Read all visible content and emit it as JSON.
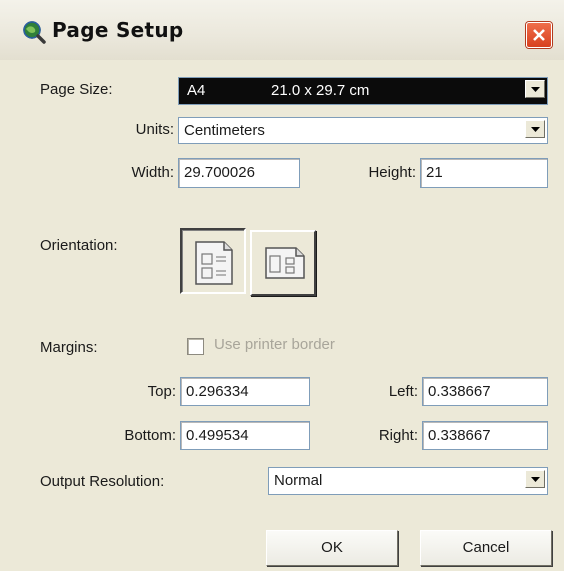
{
  "window": {
    "title": "Page Setup",
    "icon": "globe-magnifier-icon",
    "close_icon": "close-icon"
  },
  "page_size": {
    "label": "Page Size:",
    "value_name": "A4",
    "value_dims": "21.0 x 29.7 cm"
  },
  "units": {
    "label": "Units:",
    "value": "Centimeters"
  },
  "dimensions": {
    "width_label": "Width:",
    "width_value": "29.700026",
    "height_label": "Height:",
    "height_value": "21"
  },
  "orientation": {
    "label": "Orientation:",
    "portrait_icon": "portrait-icon",
    "landscape_icon": "landscape-icon",
    "selected": "portrait"
  },
  "margins": {
    "label": "Margins:",
    "use_printer_border_label": "Use printer border",
    "use_printer_border_checked": false,
    "top_label": "Top:",
    "top_value": "0.296334",
    "left_label": "Left:",
    "left_value": "0.338667",
    "bottom_label": "Bottom:",
    "bottom_value": "0.499534",
    "right_label": "Right:",
    "right_value": "0.338667"
  },
  "output_resolution": {
    "label": "Output Resolution:",
    "value": "Normal"
  },
  "buttons": {
    "ok": "OK",
    "cancel": "Cancel"
  },
  "colors": {
    "dialog_bg": "#ece9d8",
    "close_button": "#d8401f",
    "selected_combo_bg": "#0b0b0b"
  }
}
